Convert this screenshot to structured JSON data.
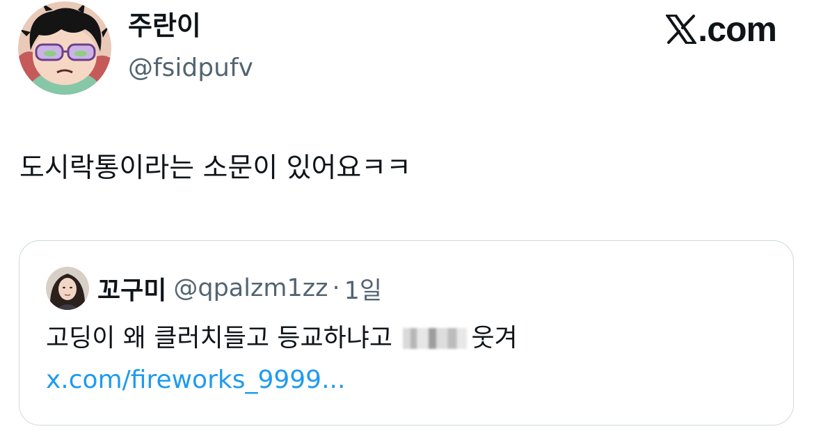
{
  "author": {
    "display_name": "주란이",
    "handle": "@fsidpufv",
    "avatar": "cartoon-avatar-icon"
  },
  "brand": {
    "label": "X.com",
    "icon": "x-logo-icon"
  },
  "tweet": {
    "text": "도시락통이라는 소문이 있어요ㅋㅋ"
  },
  "quote": {
    "display_name": "꼬구미",
    "handle": "@qpalzm1zz",
    "separator": "·",
    "time": "1일",
    "avatar": "profile-photo-icon",
    "text_before": "고딩이 왜 클러치들고 등교하냐고",
    "text_after": "웃겨",
    "link_text": "x.com/fireworks_9999...",
    "link_color": "#1d9bf0"
  },
  "colors": {
    "text": "#0f1419",
    "secondary": "#536471",
    "border": "#cfd9de",
    "link": "#1d9bf0"
  }
}
